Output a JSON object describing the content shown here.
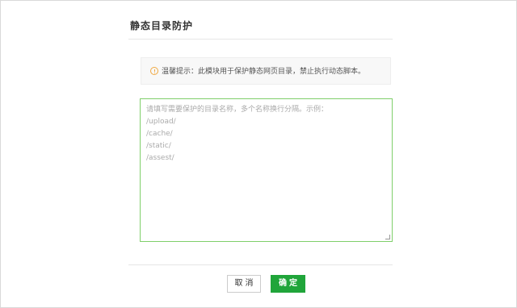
{
  "dialog": {
    "title": "静态目录防护"
  },
  "notice": {
    "icon": "warning-circle-icon",
    "text": "温馨提示：此模块用于保护静态网页目录，禁止执行动态脚本。"
  },
  "directory_input": {
    "value": "",
    "placeholder": "请填写需要保护的目录名称，多个名称换行分隔。示例：\n/upload/\n/cache/\n/static/\n/assest/"
  },
  "buttons": {
    "cancel_label": "取消",
    "confirm_label": "确定"
  },
  "colors": {
    "accent": "#20a53a",
    "input_border": "#7fcf6a",
    "warning": "#f0a840"
  }
}
